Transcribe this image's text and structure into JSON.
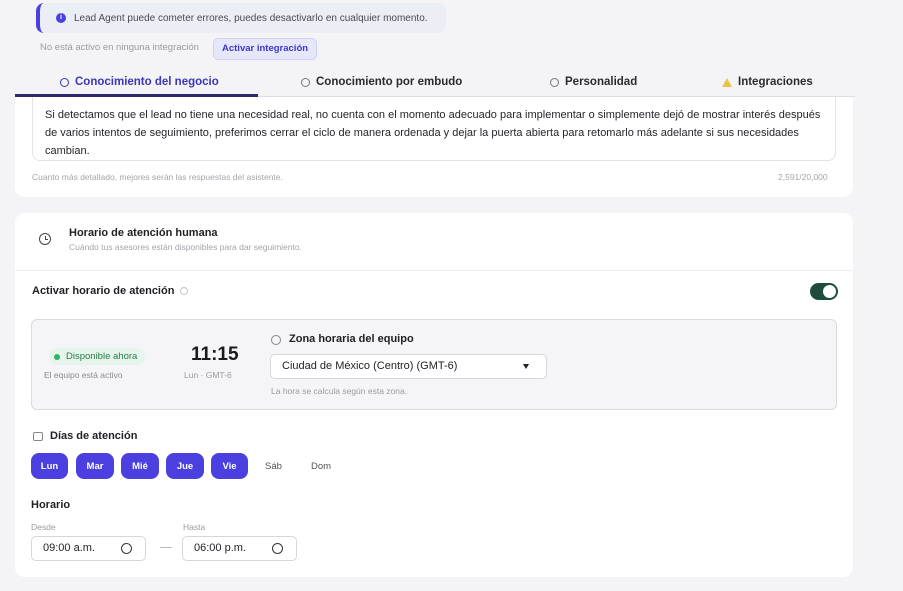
{
  "alert": {
    "text": "Lead Agent puede cometer errores, puedes desactivarlo en cualquier momento.",
    "accent": "#4b3fe0"
  },
  "integration": {
    "status": "No está activo en ninguna integración",
    "button_label": "Activar integración"
  },
  "tabs": [
    {
      "label": "Conocimiento del negocio",
      "active": true
    },
    {
      "label": "Conocimiento por embudo",
      "active": false
    },
    {
      "label": "Personalidad",
      "active": false
    },
    {
      "label": "Integraciones",
      "active": false
    }
  ],
  "knowledge": {
    "text": "Si detectamos que el lead no tiene una necesidad real, no cuenta con el momento adecuado para implementar o simplemente dejó de mostrar interés después de varios intentos de seguimiento, preferimos cerrar el ciclo de manera ordenada y dejar la puerta abierta para retomarlo más adelante si sus necesidades cambian.",
    "hint": "Cuanto más detallado, mejores serán las respuestas del asistente.",
    "count": "2,591/20,000"
  },
  "schedule": {
    "title": "Horario de atención humana",
    "subtitle": "Cuándo tus asesores están disponibles para dar seguimiento.",
    "toggle_label": "Activar horario de atención",
    "toggle_on": true,
    "status_badge": "Disponible ahora",
    "team_status": "El equipo está activo",
    "current_time": "11:15",
    "current_day_tz": "Lun · GMT-6",
    "tz_title": "Zona horaria del equipo",
    "tz_value": "Ciudad de México (Centro) (GMT-6)",
    "tz_note": "La hora se calcula según esta zona.",
    "days_title": "Días de atención",
    "days": [
      {
        "label": "Lun",
        "on": true
      },
      {
        "label": "Mar",
        "on": true
      },
      {
        "label": "Mié",
        "on": true
      },
      {
        "label": "Jue",
        "on": true
      },
      {
        "label": "Vie",
        "on": true
      },
      {
        "label": "Sáb",
        "on": false
      },
      {
        "label": "Dom",
        "on": false
      }
    ],
    "hours_title": "Horario",
    "from_label": "Desde",
    "from_value": "09:00 a.m.",
    "to_label": "Hasta",
    "to_value": "06:00 p.m."
  }
}
